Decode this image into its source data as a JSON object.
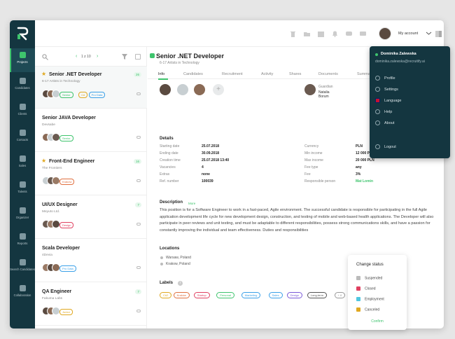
{
  "sidebar": {
    "items": [
      {
        "label": "Projects",
        "icon": "projects-icon"
      },
      {
        "label": "Candidates",
        "icon": "candidates-icon"
      },
      {
        "label": "Clients",
        "icon": "clients-icon"
      },
      {
        "label": "Contacts",
        "icon": "contacts-icon"
      },
      {
        "label": "Sales",
        "icon": "sales-icon"
      },
      {
        "label": "Talents",
        "icon": "talents-icon"
      },
      {
        "label": "Organizer",
        "icon": "organizer-icon"
      },
      {
        "label": "Reports",
        "icon": "reports-icon"
      },
      {
        "label": "Search Candidates",
        "icon": "search-icon"
      },
      {
        "label": "Collaboration",
        "icon": "collaboration-icon"
      }
    ]
  },
  "topbar": {
    "account_label": "My account"
  },
  "list": {
    "pager": "1 z 10",
    "cards": [
      {
        "title": "Senior .NET Developer",
        "sub": "6-17 Artists in Technology",
        "count": "26",
        "tags": [
          {
            "t": "Senior",
            "c": "#3ec46d"
          },
          {
            "t": "C#",
            "c": "#e0a820"
          },
          {
            "t": "Pro Data",
            "c": "#3aa0e8"
          }
        ]
      },
      {
        "title": "Senior JAVA Developer",
        "sub": "Devsabe",
        "count": "",
        "tags": [
          {
            "t": "Senior",
            "c": "#3ec46d"
          }
        ]
      },
      {
        "title": "Front-End Engineer",
        "sub": "The Frontiers",
        "count": "16",
        "tags": [
          {
            "t": "Kraków",
            "c": "#e07040"
          }
        ]
      },
      {
        "title": "UI/UX Designer",
        "sub": "Meyuto Ltd.",
        "count": "7",
        "tags": [
          {
            "t": "Design",
            "c": "#e04060"
          }
        ]
      },
      {
        "title": "Scala Developer",
        "sub": "4Devia",
        "count": "",
        "tags": [
          {
            "t": "Pro Data",
            "c": "#3aa0e8"
          }
        ]
      },
      {
        "title": "QA Engineer",
        "sub": "Fakuma Labs",
        "count": "7",
        "tags": [
          {
            "t": "Junior",
            "c": "#e0a820"
          }
        ]
      }
    ]
  },
  "detail": {
    "title": "Senior .NET Developer",
    "subtitle": "6-17 Artists in Technology",
    "tabs": [
      "Info",
      "Candidates",
      "Recruitment",
      "Activity",
      "Shares",
      "Documents",
      "Summary"
    ],
    "guardian_label": "Guardian",
    "guardian_name": "Natalia Borum",
    "details_header": "Details",
    "left_fields": [
      {
        "k": "Starting date",
        "v": "25.07.2018"
      },
      {
        "k": "Ending date",
        "v": "30.09.2018"
      },
      {
        "k": "Creation time",
        "v": "25.07.2018 13:40"
      },
      {
        "k": "Vacancies",
        "v": "4"
      },
      {
        "k": "Extras",
        "v": "none"
      },
      {
        "k": "Ref. number",
        "v": "100039"
      }
    ],
    "right_fields": [
      {
        "k": "Currency",
        "v": "PLN"
      },
      {
        "k": "Min income",
        "v": "12 000 PLN"
      },
      {
        "k": "Max income",
        "v": "20 000 PLN"
      },
      {
        "k": "Fee type",
        "v": "any"
      },
      {
        "k": "Fee",
        "v": "3%"
      },
      {
        "k": "Responsible person",
        "v": "Mat Lomin"
      }
    ],
    "description_header": "Description",
    "description_more": "More",
    "description": "This position is for a Software Engineer to work in a fast-paced, Agile environment. The successful candidate is responsible for participating in the full Agile application development life cycle for new development design, construction, and testing of mobile and web-based health applications. The Developer will also participate in peer reviews and unit testing, and must be adaptable to different responsibilities, possess strong communications skills, and have a passion for constantly improving the individual and team effectiveness. Duties and responsibilities",
    "locations_header": "Locations",
    "locations": [
      "Warsaw, Poland",
      "Krakow, Poland"
    ],
    "labels_header": "Labels",
    "labels": [
      {
        "t": "C#2",
        "c": "#e0a820"
      },
      {
        "t": "Kraków",
        "c": "#e07040"
      },
      {
        "t": "Startup",
        "c": "#e04060"
      },
      {
        "t": "Personal",
        "c": "#3ec46d"
      },
      {
        "t": "Marketing",
        "c": "#3aa0e8"
      },
      {
        "t": "Sales",
        "c": "#3aa0e8"
      },
      {
        "t": "Design",
        "c": "#7a5ad8"
      },
      {
        "t": "Long-term",
        "c": "#555555"
      },
      {
        "t": "+ 8",
        "c": "#999999"
      }
    ]
  },
  "account_menu": {
    "name": "Dominika Zalewska",
    "email": "dominika.zalewska@recruitify.ai",
    "items": [
      {
        "t": "Profile",
        "icon": "profile-icon"
      },
      {
        "t": "Settings",
        "icon": "gear-icon"
      },
      {
        "t": "Language",
        "icon": "flag-icon"
      },
      {
        "t": "Help",
        "icon": "help-icon"
      },
      {
        "t": "About",
        "icon": "info-icon"
      },
      {
        "t": "Logout",
        "icon": "logout-icon"
      }
    ]
  },
  "status_popup": {
    "title": "Change status",
    "items": [
      {
        "t": "Suspended",
        "c": "#bbbbbb"
      },
      {
        "t": "Closed",
        "c": "#e04060"
      },
      {
        "t": "Employment",
        "c": "#4fc6e0"
      },
      {
        "t": "Canceled",
        "c": "#e0a820"
      }
    ],
    "confirm": "Confirm"
  },
  "colors": {
    "accent": "#3ec46d",
    "sidebar": "#143640"
  }
}
